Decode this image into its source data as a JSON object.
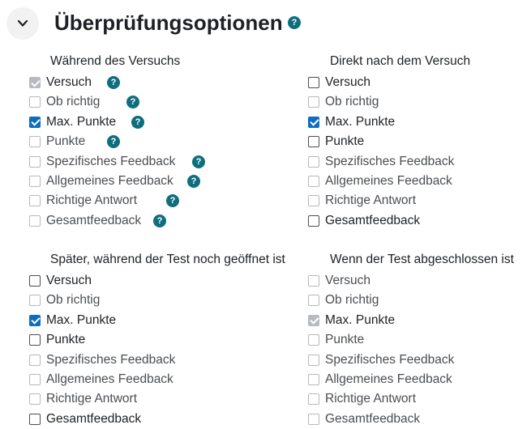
{
  "section": {
    "title": "Überprüfungsoptionen",
    "help": "?"
  },
  "groups": [
    {
      "title": "Während des Versuchs",
      "options": [
        {
          "label": "Versuch",
          "checked": true,
          "disabled": true,
          "light": true,
          "help": "?"
        },
        {
          "label": "Ob richtig",
          "checked": false,
          "disabled": false,
          "light": true,
          "help": "?"
        },
        {
          "label": "Max. Punkte",
          "checked": true,
          "disabled": false,
          "light": false,
          "help": "?"
        },
        {
          "label": "Punkte",
          "checked": false,
          "disabled": false,
          "light": true,
          "help": "?"
        },
        {
          "label": "Spezifisches Feedback",
          "checked": false,
          "disabled": false,
          "light": true,
          "help": "?"
        },
        {
          "label": "Allgemeines Feedback",
          "checked": false,
          "disabled": false,
          "light": true,
          "help": "?"
        },
        {
          "label": "Richtige Antwort",
          "checked": false,
          "disabled": false,
          "light": true,
          "help": "?"
        },
        {
          "label": "Gesamtfeedback",
          "checked": false,
          "disabled": false,
          "light": true,
          "help": "?"
        }
      ]
    },
    {
      "title": "Direkt nach dem Versuch",
      "options": [
        {
          "label": "Versuch",
          "checked": false,
          "disabled": false,
          "light": false
        },
        {
          "label": "Ob richtig",
          "checked": false,
          "disabled": false,
          "light": true
        },
        {
          "label": "Max. Punkte",
          "checked": true,
          "disabled": false,
          "light": false
        },
        {
          "label": "Punkte",
          "checked": false,
          "disabled": false,
          "light": false
        },
        {
          "label": "Spezifisches Feedback",
          "checked": false,
          "disabled": false,
          "light": true
        },
        {
          "label": "Allgemeines Feedback",
          "checked": false,
          "disabled": false,
          "light": true
        },
        {
          "label": "Richtige Antwort",
          "checked": false,
          "disabled": false,
          "light": true
        },
        {
          "label": "Gesamtfeedback",
          "checked": false,
          "disabled": false,
          "light": false
        }
      ]
    },
    {
      "title": "Später, während der Test noch geöffnet ist",
      "options": [
        {
          "label": "Versuch",
          "checked": false,
          "disabled": false,
          "light": false
        },
        {
          "label": "Ob richtig",
          "checked": false,
          "disabled": false,
          "light": true
        },
        {
          "label": "Max. Punkte",
          "checked": true,
          "disabled": false,
          "light": false
        },
        {
          "label": "Punkte",
          "checked": false,
          "disabled": false,
          "light": false
        },
        {
          "label": "Spezifisches Feedback",
          "checked": false,
          "disabled": false,
          "light": true
        },
        {
          "label": "Allgemeines Feedback",
          "checked": false,
          "disabled": false,
          "light": true
        },
        {
          "label": "Richtige Antwort",
          "checked": false,
          "disabled": false,
          "light": true
        },
        {
          "label": "Gesamtfeedback",
          "checked": false,
          "disabled": false,
          "light": false
        }
      ]
    },
    {
      "title": "Wenn der Test abgeschlossen ist",
      "options": [
        {
          "label": "Versuch",
          "checked": false,
          "disabled": false,
          "light": true
        },
        {
          "label": "Ob richtig",
          "checked": false,
          "disabled": false,
          "light": true
        },
        {
          "label": "Max. Punkte",
          "checked": true,
          "disabled": true,
          "light": true
        },
        {
          "label": "Punkte",
          "checked": false,
          "disabled": false,
          "light": true
        },
        {
          "label": "Spezifisches Feedback",
          "checked": false,
          "disabled": false,
          "light": true
        },
        {
          "label": "Allgemeines Feedback",
          "checked": false,
          "disabled": false,
          "light": true
        },
        {
          "label": "Richtige Antwort",
          "checked": false,
          "disabled": false,
          "light": true
        },
        {
          "label": "Gesamtfeedback",
          "checked": false,
          "disabled": false,
          "light": true
        }
      ]
    }
  ]
}
